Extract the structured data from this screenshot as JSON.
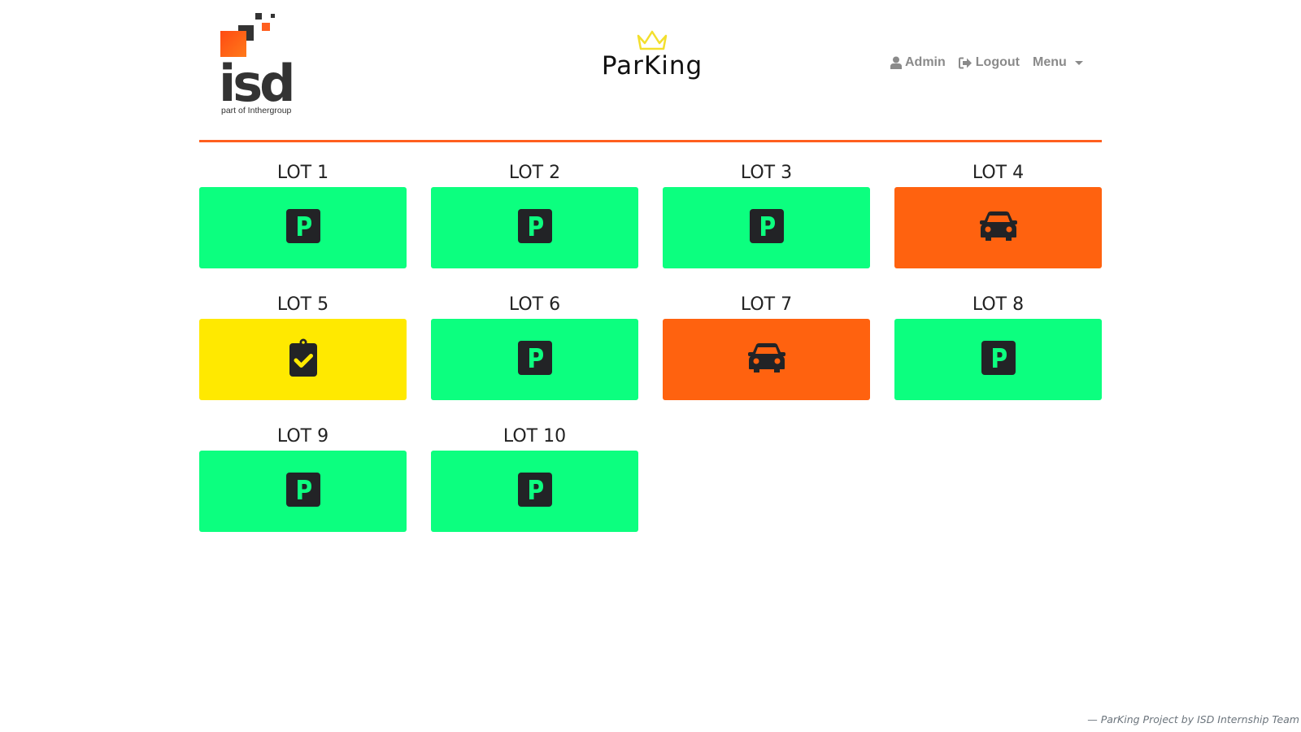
{
  "header": {
    "brand": {
      "name": "isd",
      "tagline": "part of Inthergroup",
      "icon": "isd-logo",
      "colors": {
        "orange": "#ff5f1f",
        "dark": "#333333"
      }
    },
    "app": {
      "name": "ParKing",
      "icon": "crown-icon",
      "crown_color": "#f3df2d"
    },
    "nav": {
      "user_label": "Admin",
      "user_icon": "user-icon",
      "logout_label": "Logout",
      "logout_icon": "sign-out-icon",
      "menu_label": "Menu"
    }
  },
  "status_colors": {
    "free": "#0cff7f",
    "occupied": "#ff620f",
    "reserved": "#ffe900"
  },
  "lots": [
    {
      "label": "LOT 1",
      "status": "free",
      "icon": "parking-icon"
    },
    {
      "label": "LOT 2",
      "status": "free",
      "icon": "parking-icon"
    },
    {
      "label": "LOT 3",
      "status": "free",
      "icon": "parking-icon"
    },
    {
      "label": "LOT 4",
      "status": "occupied",
      "icon": "car-icon"
    },
    {
      "label": "LOT 5",
      "status": "reserved",
      "icon": "clipboard-check-icon"
    },
    {
      "label": "LOT 6",
      "status": "free",
      "icon": "parking-icon"
    },
    {
      "label": "LOT 7",
      "status": "occupied",
      "icon": "car-icon"
    },
    {
      "label": "LOT 8",
      "status": "free",
      "icon": "parking-icon"
    },
    {
      "label": "LOT 9",
      "status": "free",
      "icon": "parking-icon"
    },
    {
      "label": "LOT 10",
      "status": "free",
      "icon": "parking-icon"
    }
  ],
  "footer": {
    "text": "— ParKing Project by ISD Internship Team"
  }
}
